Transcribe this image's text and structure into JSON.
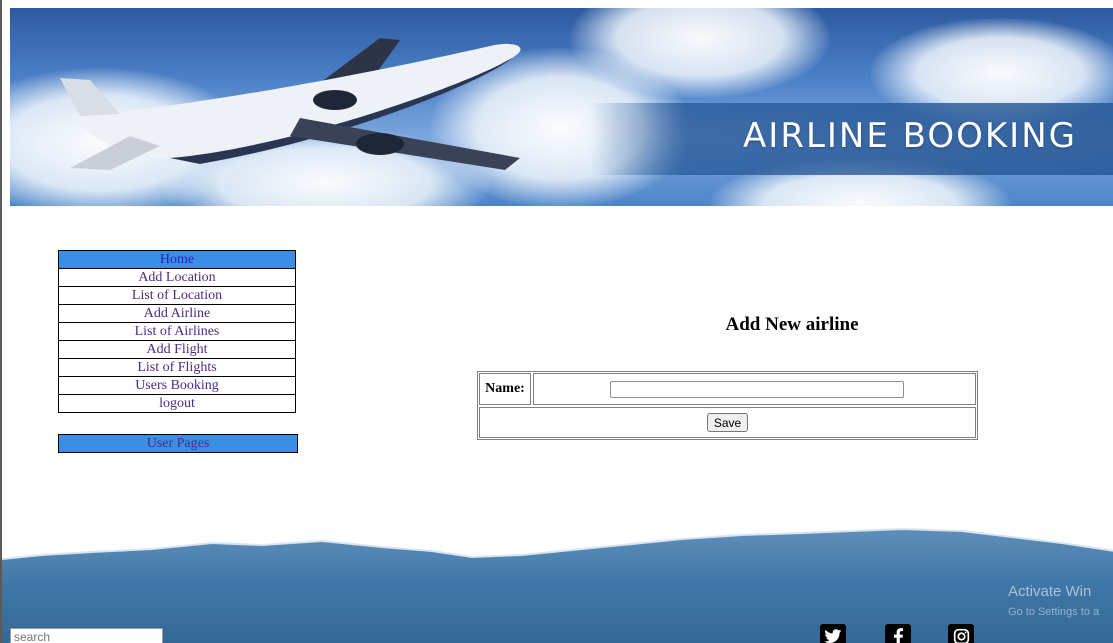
{
  "header": {
    "banner_title": "AIRLINE BOOKING"
  },
  "sidebar": {
    "items": [
      {
        "label": "Home",
        "active": true
      },
      {
        "label": "Add Location"
      },
      {
        "label": "List of Location"
      },
      {
        "label": "Add Airline"
      },
      {
        "label": "List of Airlines"
      },
      {
        "label": "Add Flight"
      },
      {
        "label": "List of Flights"
      },
      {
        "label": "Users Booking"
      },
      {
        "label": "logout"
      }
    ],
    "user_pages_label": "User Pages"
  },
  "main": {
    "heading": "Add New airline",
    "form": {
      "name_label": "Name:",
      "name_value": "",
      "save_label": "Save"
    }
  },
  "footer": {
    "search_placeholder": "search",
    "social_icons": [
      "twitter-icon",
      "facebook-icon",
      "instagram-icon"
    ]
  },
  "overlay": {
    "watermark_title": "Activate Win",
    "watermark_sub": "Go to Settings to a"
  },
  "colors": {
    "nav_active_bg": "#3a8fe4",
    "nav_link": "#4b2a86",
    "footer_blue": "#3f76a6"
  }
}
